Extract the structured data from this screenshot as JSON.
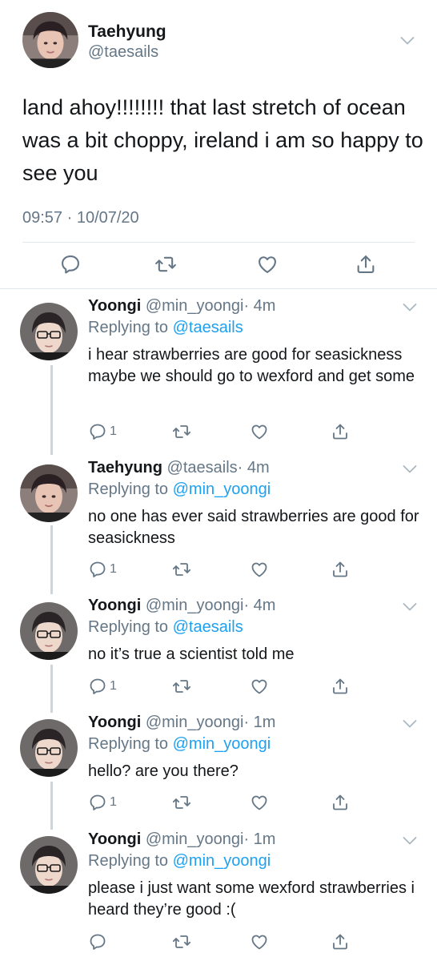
{
  "main_tweet": {
    "name": "Taehyung",
    "handle": "@taesails",
    "text": "land ahoy!!!!!!!! that last stretch of ocean was a bit choppy, ireland i am so happy to see you",
    "timestamp": "09:57 · 10/07/20"
  },
  "replies": [
    {
      "name": "Yoongi",
      "handle": "@min_yoongi",
      "time": "· 4m",
      "replying_prefix": "Replying to ",
      "replying_to": "@taesails",
      "text": "i hear strawberries are good for seasickness maybe we should go to wexford and get some",
      "reply_count": "1",
      "avatar": "yoongi"
    },
    {
      "name": "Taehyung",
      "handle": "@taesails",
      "time": "· 4m",
      "replying_prefix": "Replying to ",
      "replying_to": "@min_yoongi",
      "text": "no one has ever said strawberries are good for seasickness",
      "reply_count": "1",
      "avatar": "taehyung"
    },
    {
      "name": "Yoongi",
      "handle": "@min_yoongi",
      "time": "· 4m",
      "replying_prefix": "Replying to ",
      "replying_to": "@taesails",
      "text": "no it’s true a scientist told me",
      "reply_count": "1",
      "avatar": "yoongi"
    },
    {
      "name": "Yoongi",
      "handle": "@min_yoongi",
      "time": "· 1m",
      "replying_prefix": "Replying to ",
      "replying_to": "@min_yoongi",
      "text": "hello? are you there?",
      "reply_count": "1",
      "avatar": "yoongi"
    },
    {
      "name": "Yoongi",
      "handle": "@min_yoongi",
      "time": "· 1m",
      "replying_prefix": "Replying to ",
      "replying_to": "@min_yoongi",
      "text": "please i just want some wexford strawberries i heard they’re good :(",
      "reply_count": "",
      "avatar": "yoongi"
    }
  ],
  "icons": {
    "reply": "reply-icon",
    "retweet": "retweet-icon",
    "like": "heart-icon",
    "share": "share-icon",
    "more": "chevron-down-icon"
  },
  "colors": {
    "text": "#14171a",
    "secondary": "#657786",
    "link": "#1da1f2",
    "divider": "#e1e8ed",
    "thread_line": "#ccd6dd"
  }
}
